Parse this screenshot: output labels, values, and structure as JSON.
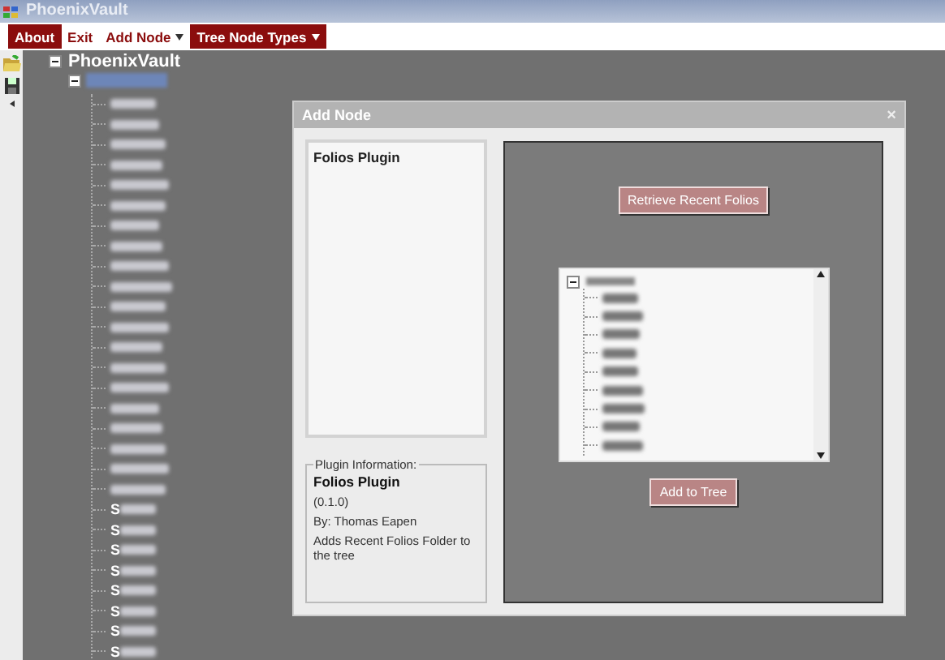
{
  "window": {
    "title": "PhoenixVault"
  },
  "menu": [
    {
      "label": "About",
      "kind": "item",
      "selected": true
    },
    {
      "label": "Exit",
      "kind": "item",
      "selected": false
    },
    {
      "label": "Add Node",
      "kind": "dropdown",
      "selected": false
    },
    {
      "label": "Tree Node Types",
      "kind": "dropdown",
      "selected": true
    }
  ],
  "tree": {
    "label": "PhoenixVault",
    "expanded": true,
    "children": [
      {
        "redacted": true,
        "selected": true,
        "expanded": true,
        "children": [
          {
            "redacted": true
          },
          {
            "redacted": true
          },
          {
            "redacted": true
          },
          {
            "redacted": true
          },
          {
            "redacted": true
          },
          {
            "redacted": true
          },
          {
            "redacted": true
          },
          {
            "redacted": true
          },
          {
            "redacted": true
          },
          {
            "redacted": true
          },
          {
            "redacted": true
          },
          {
            "redacted": true
          },
          {
            "redacted": true
          },
          {
            "redacted": true
          },
          {
            "redacted": true
          },
          {
            "redacted": true
          },
          {
            "redacted": true
          },
          {
            "redacted": true
          },
          {
            "redacted": true
          },
          {
            "redacted": true
          },
          {
            "label": "S",
            "redacted": true
          },
          {
            "label": "S",
            "redacted": true
          },
          {
            "label": "S",
            "redacted": true
          },
          {
            "label": "S",
            "redacted": true
          },
          {
            "label": "S",
            "redacted": true
          },
          {
            "label": "S",
            "redacted": true
          },
          {
            "label": "S",
            "redacted": true
          },
          {
            "label": "S",
            "redacted": true
          }
        ]
      }
    ]
  },
  "dialog": {
    "title": "Add Node",
    "close": "×",
    "plugins": [
      {
        "label": "Folios Plugin",
        "selected": false
      }
    ],
    "plugin_info": {
      "legend": "Plugin Information:",
      "name": "Folios Plugin",
      "version": "(0.1.0)",
      "author": "By: Thomas Eapen",
      "description": "Adds Recent Folios Folder to the tree"
    },
    "retrieve_button": "Retrieve Recent Folios",
    "folio_tree": {
      "redacted": true,
      "expanded": true,
      "children": [
        {
          "redacted": true
        },
        {
          "redacted": true
        },
        {
          "redacted": true
        },
        {
          "redacted": true
        },
        {
          "redacted": true
        },
        {
          "redacted": true
        },
        {
          "redacted": true
        },
        {
          "redacted": true
        },
        {
          "redacted": true
        }
      ]
    },
    "add_button": "Add to Tree"
  }
}
